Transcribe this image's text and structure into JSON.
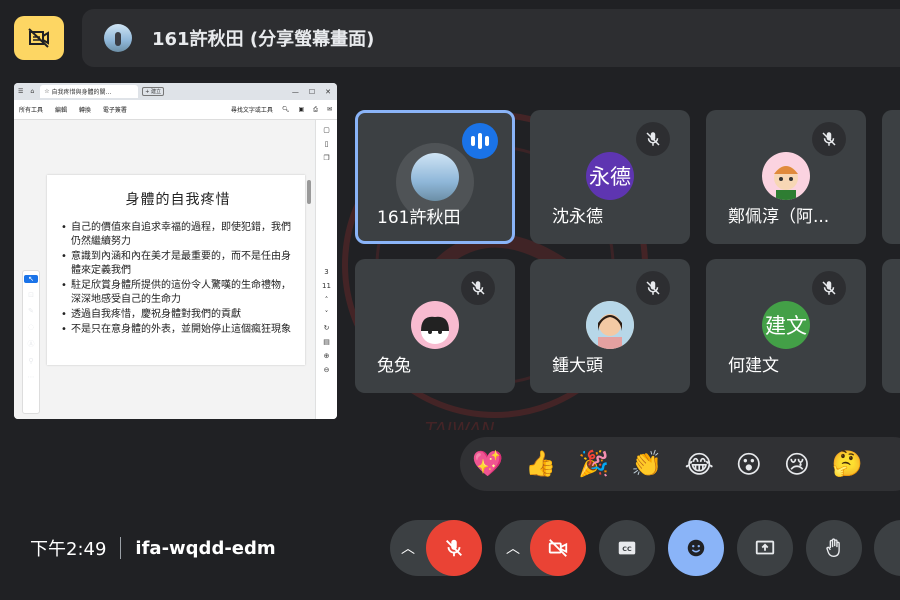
{
  "presenter": {
    "name_text": "161許秋田 (分享螢幕畫面)"
  },
  "shared_screen": {
    "tab_title": "自我疼惜與身體的關...",
    "new_tab_label": "建立",
    "menu": [
      "所有工具",
      "編輯",
      "轉換",
      "電子簽署"
    ],
    "find_text_label": "尋找文字或工具",
    "slide": {
      "title": "身體的自我疼惜",
      "bullets": [
        "自己的價值來自追求幸福的過程，即使犯錯，我們仍然繼續努力",
        "意識到內涵和內在美才是最重要的，而不是任由身體來定義我們",
        "駐足欣賞身體所提供的這份令人驚嘆的生命禮物，深深地感受自己的生命力",
        "透過自我疼惜，慶祝身體對我們的貢獻",
        "不是只在意身體的外表，並開始停止這個瘋狂現象"
      ]
    },
    "page_current": "3",
    "page_total": "11"
  },
  "participants": [
    {
      "name": "161許秋田",
      "initials": "",
      "speaking": true,
      "avatar_color": "#8fb7d9"
    },
    {
      "name": "沈永德",
      "initials": "永德",
      "speaking": false,
      "avatar_color": "#5e35b1"
    },
    {
      "name": "鄭佩淳（阿...",
      "initials": "",
      "speaking": false,
      "avatar_color": "#fbd3e0"
    },
    {
      "name": "兔兔",
      "initials": "",
      "speaking": false,
      "avatar_color": "#f8bbd0"
    },
    {
      "name": "鍾大頭",
      "initials": "",
      "speaking": false,
      "avatar_color": "#c5a47e"
    },
    {
      "name": "何建文",
      "initials": "建文",
      "speaking": false,
      "avatar_color": "#43a047"
    }
  ],
  "watermark": {
    "text": "TAIWAN"
  },
  "reactions": [
    "💖",
    "👍",
    "🎉",
    "👏",
    "😂",
    "😮",
    "😢",
    "🤔"
  ],
  "footer": {
    "time": "下午2:49",
    "meeting_code": "ifa-wqdd-edm"
  },
  "colors": {
    "accent_yellow": "#fdd663",
    "mute_red": "#ea4335",
    "active_blue": "#8ab4f8"
  }
}
